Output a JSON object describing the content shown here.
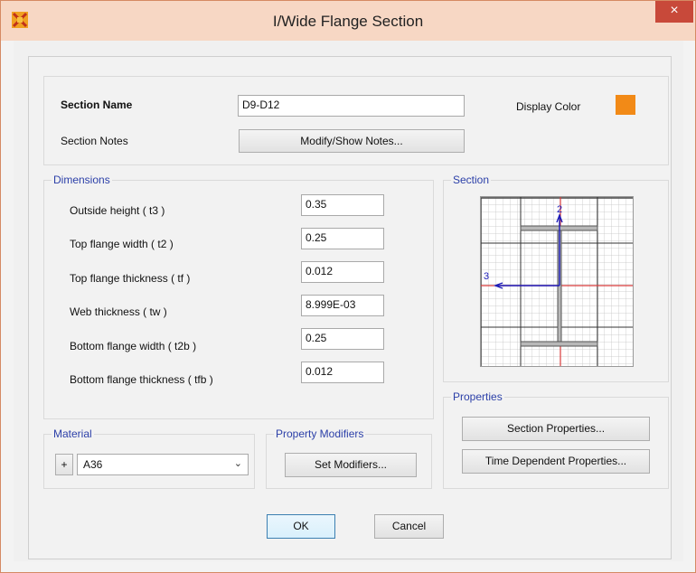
{
  "window": {
    "title": "I/Wide Flange Section",
    "close_label": "×"
  },
  "section_name": {
    "label": "Section Name",
    "value": "D9-D12"
  },
  "display_color": {
    "label": "Display Color",
    "color": "#f28a17"
  },
  "section_notes": {
    "label": "Section Notes",
    "button_label": "Modify/Show Notes..."
  },
  "dimensions": {
    "title": "Dimensions",
    "rows": [
      {
        "label": "Outside height  ( t3 )",
        "value": "0.35"
      },
      {
        "label": "Top flange width  ( t2 )",
        "value": "0.25"
      },
      {
        "label": "Top flange thickness  ( tf )",
        "value": "0.012"
      },
      {
        "label": "Web thickness  ( tw )",
        "value": "8.999E-03"
      },
      {
        "label": "Bottom flange width  ( t2b )",
        "value": "0.25"
      },
      {
        "label": "Bottom flange thickness  ( tfb )",
        "value": "0.012"
      }
    ]
  },
  "section_view": {
    "title": "Section",
    "axis_2_label": "2",
    "axis_3_label": "3"
  },
  "properties": {
    "title": "Properties",
    "section_button": "Section Properties...",
    "time_button": "Time Dependent Properties..."
  },
  "material": {
    "title": "Material",
    "add_label": "+",
    "value": "A36"
  },
  "modifiers": {
    "title": "Property Modifiers",
    "button_label": "Set Modifiers..."
  },
  "footer": {
    "ok_label": "OK",
    "cancel_label": "Cancel"
  }
}
